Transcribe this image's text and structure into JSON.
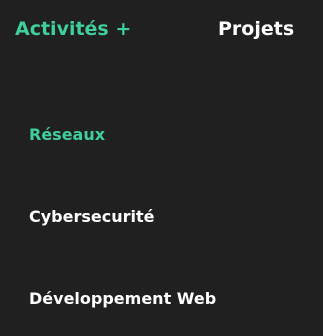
{
  "nav": {
    "activites_label": "Activités +",
    "projets_label": "Projets"
  },
  "dropdown": {
    "items": [
      {
        "label": "Réseaux",
        "active": true
      },
      {
        "label": "Cybersecurité",
        "active": false
      },
      {
        "label": "Développement Web",
        "active": false
      }
    ]
  },
  "colors": {
    "background": "#202020",
    "accent": "#3fcf9a",
    "text": "#ffffff"
  }
}
